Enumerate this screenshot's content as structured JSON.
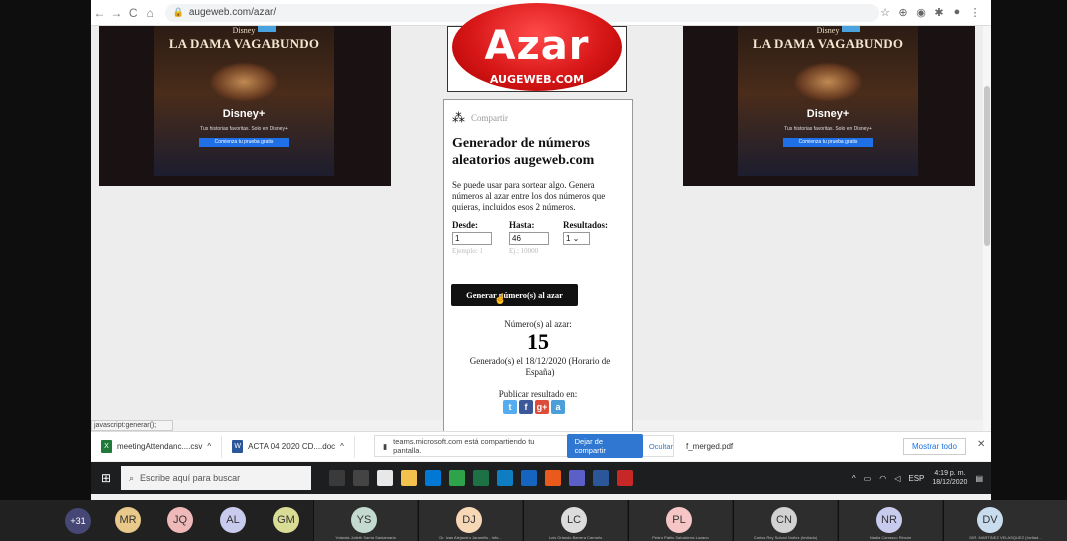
{
  "browser": {
    "url": "augeweb.com/azar/",
    "nav_back": "←",
    "nav_forward": "→",
    "nav_reload": "C",
    "nav_home": "⌂",
    "ext_icons": [
      "☆",
      "⊕",
      "◉",
      "✱",
      "●",
      "⋮"
    ]
  },
  "ads": {
    "brand": "Disney",
    "title": "LA DAMA VAGABUNDO",
    "plus": "Disney+",
    "tagline": "Tus historias favoritas. Solo en Disney+",
    "cta": "Comienza tu prueba gratis"
  },
  "logo": {
    "title": "Azar",
    "subtitle": "AUGEWEB.COM"
  },
  "card": {
    "share_label": "Compartir",
    "title": "Generador de números aleatorios augeweb.com",
    "description": "Se puede usar para sortear algo. Genera números al azar entre los dos números que quieras, incluidos esos 2 números.",
    "from_label": "Desde:",
    "to_label": "Hasta:",
    "results_label": "Resultados:",
    "from_value": "1",
    "to_value": "46",
    "results_value": "1 ⌄",
    "from_hint": "Ejemplo: 1",
    "to_hint": "Ej.: 10000",
    "generate_button": "Generar número(s) al azar",
    "result_label": "Número(s) al azar:",
    "result_number": "15",
    "result_date": "Generado(s) el 18/12/2020 (Horario de España)",
    "publish_label": "Publicar resultado en:",
    "social": [
      "t",
      "f",
      "g+",
      "a"
    ]
  },
  "status_tooltip": "javascript:generar();",
  "downloads": {
    "item1": "meetingAttendanc....csv",
    "item2": "ACTA 04 2020 CD....doc",
    "share_text": "teams.microsoft.com está compartiendo tu pantalla.",
    "stop_share": "Dejar de compartir",
    "hide": "Ocultar",
    "merged_file": "f_merged.pdf",
    "show_all": "Mostrar todo",
    "close": "✕"
  },
  "taskbar": {
    "search_placeholder": "Escribe aquí para buscar",
    "time": "4:19 p. m.",
    "date": "18/12/2020",
    "lang": "ESP"
  },
  "participants": {
    "overflow": "+31",
    "people": [
      {
        "initials": "MR",
        "color": "#e9c98a"
      },
      {
        "initials": "JQ",
        "color": "#f0b9b9"
      },
      {
        "initials": "AL",
        "color": "#c9cbee"
      },
      {
        "initials": "GM",
        "color": "#d9dc95"
      },
      {
        "initials": "YS",
        "color": "#c4d9cf",
        "name": "Yolanda Julieth Sarria Santamaría"
      },
      {
        "initials": "DJ",
        "color": "#f7d8b6",
        "name": "Dr. Ivan Alejandro Jaramillo - Info..."
      },
      {
        "initials": "LC",
        "color": "#dcdcdc",
        "name": "Luis Orlando Barrera Carmelo"
      },
      {
        "initials": "PL",
        "color": "#f6c6c6",
        "name": "Pedro Pablo Salvatierra Lozano"
      },
      {
        "initials": "CN",
        "color": "#d2d2d2",
        "name": "Carlos Rey Sulvari Nuñez (Invitado)"
      },
      {
        "initials": "NR",
        "color": "#c9cbee",
        "name": "Nadia Carrasco Rincón"
      },
      {
        "initials": "DV",
        "color": "#c9dcee",
        "name": "DIR. MARTINEZ VELASQUEZ (Invitad..."
      }
    ]
  }
}
